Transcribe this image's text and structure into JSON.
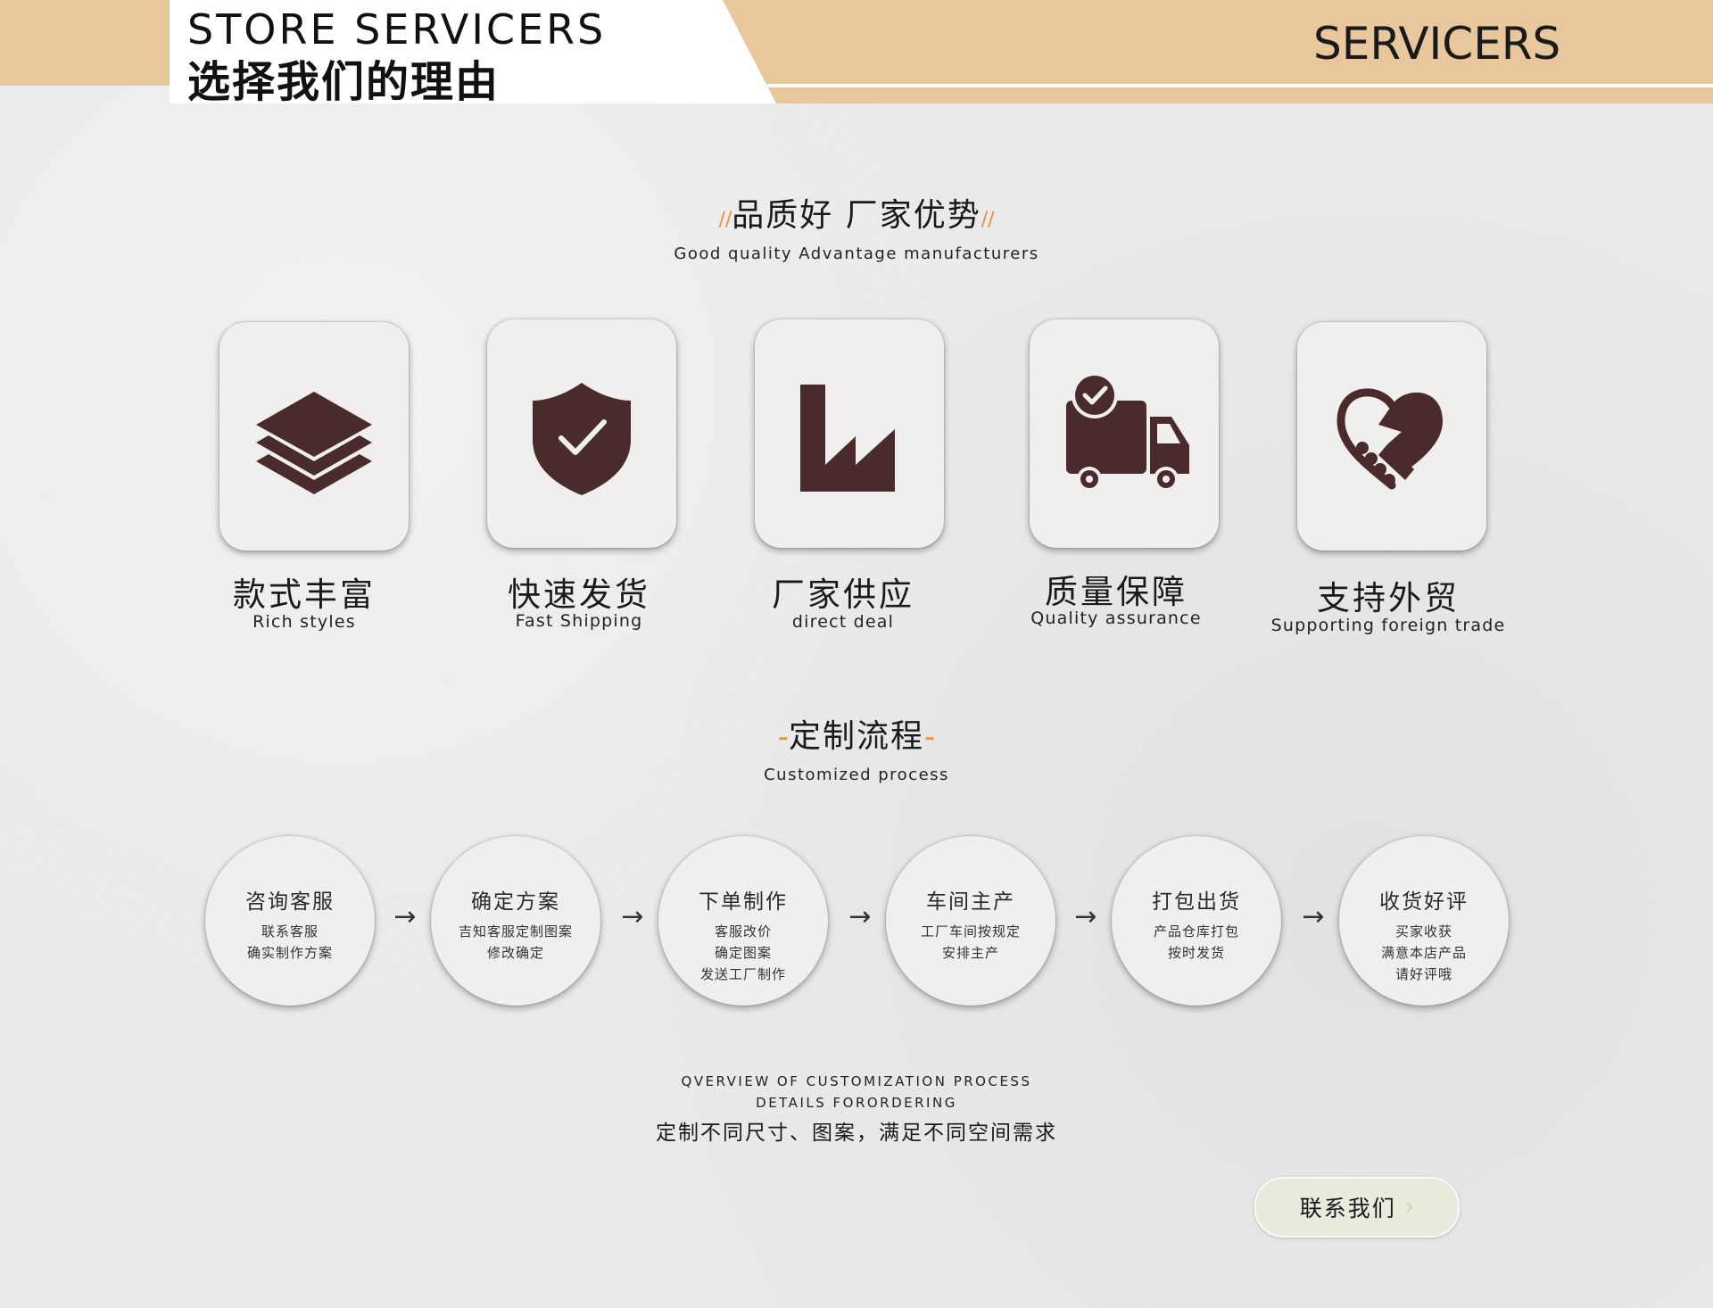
{
  "header": {
    "title_en": "STORE SERVICERS",
    "title_cn": "选择我们的理由",
    "right_label": "SERVICERS",
    "accent_color": "#e8c79d"
  },
  "quality_section": {
    "title_cn": "品质好 厂家优势",
    "deco_left": "//",
    "deco_right": "//",
    "subtitle_en": "Good quality  Advantage manufacturers",
    "features": [
      {
        "icon": "layers-icon",
        "title_cn": "款式丰富",
        "title_en": "Rich styles"
      },
      {
        "icon": "shield-check-icon",
        "title_cn": "快速发货",
        "title_en": "Fast Shipping"
      },
      {
        "icon": "factory-icon",
        "title_cn": "厂家供应",
        "title_en": "direct deal"
      },
      {
        "icon": "delivery-truck-icon",
        "title_cn": "质量保障",
        "title_en": "Quality assurance"
      },
      {
        "icon": "handshake-heart-icon",
        "title_cn": "支持外贸",
        "title_en": "Supporting foreign trade"
      }
    ],
    "icon_color": "#4a2b2b"
  },
  "process_section": {
    "title_cn": "定制流程",
    "deco": "-",
    "subtitle_en": "Customized process",
    "arrow": "→",
    "steps": [
      {
        "title": "咨询客服",
        "lines": [
          "联系客服",
          "确实制作方案"
        ]
      },
      {
        "title": "确定方案",
        "lines": [
          "吉知客服定制图案",
          "修改确定"
        ]
      },
      {
        "title": "下单制作",
        "lines": [
          "客服改价",
          "确定图案",
          "发送工厂制作"
        ]
      },
      {
        "title": "车间主产",
        "lines": [
          "工厂车间按规定",
          "安排主产"
        ]
      },
      {
        "title": "打包出货",
        "lines": [
          "产品仓库打包",
          "按时发货"
        ]
      },
      {
        "title": "收货好评",
        "lines": [
          "买家收获",
          "满意本店产品",
          "请好评哦"
        ]
      }
    ]
  },
  "overview": {
    "line1_en": "QVERVIEW OF CUSTOMIZATION PROCESS",
    "line2_en": "DETAILS FORORDERING",
    "line3_cn": "定制不同尺寸、图案，满足不同空间需求"
  },
  "contact_button": {
    "label": "联系我们",
    "icon": "chevron-right-icon",
    "color": "#e6ebdc"
  }
}
